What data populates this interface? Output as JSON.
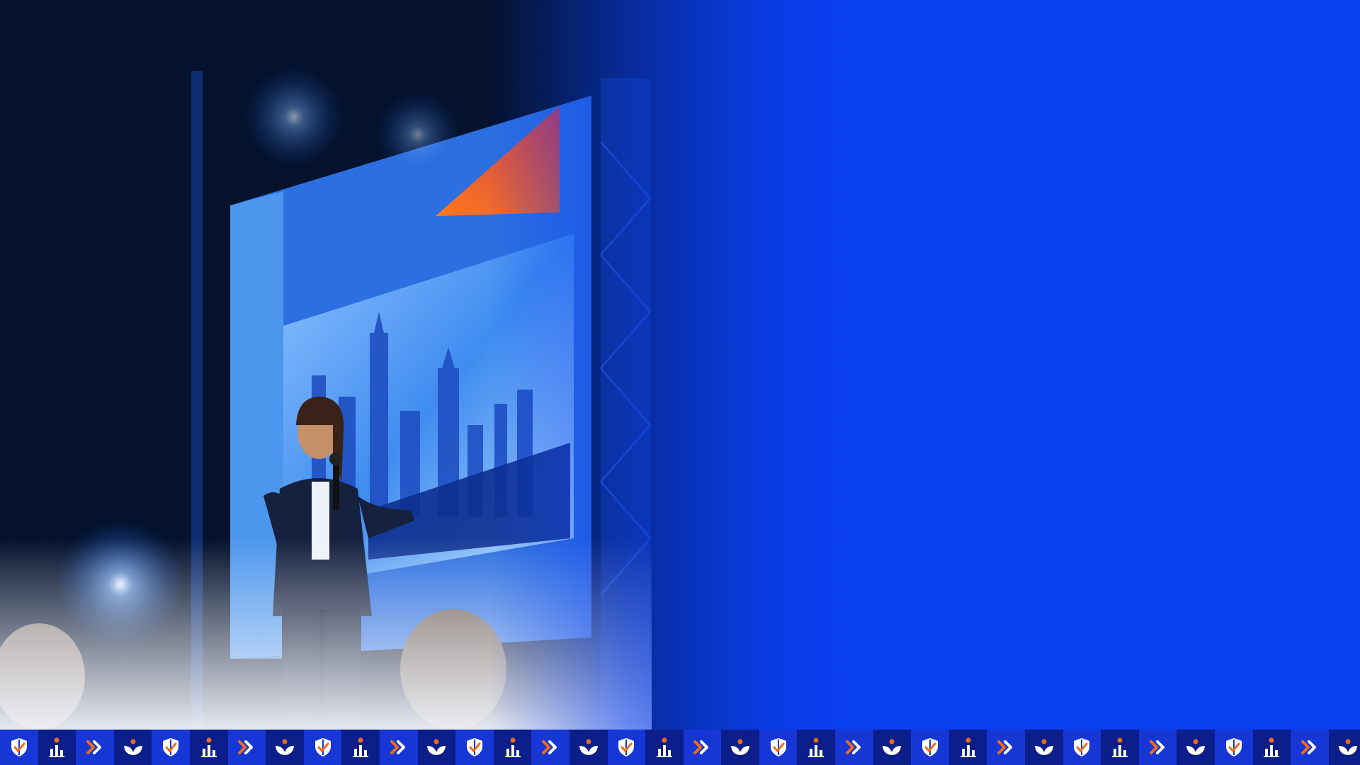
{
  "colors": {
    "brand_blue": "#0a3ff0",
    "strip_dark": "#0b1e8a",
    "strip_light": "#1636d6",
    "accent_orange": "#f06a1d",
    "icon_white": "#ffffff"
  },
  "icon_pattern": [
    "shield-check-icon",
    "people-chart-icon",
    "double-chevron-icon",
    "sprout-icon"
  ],
  "icon_strip_tiles": 36
}
